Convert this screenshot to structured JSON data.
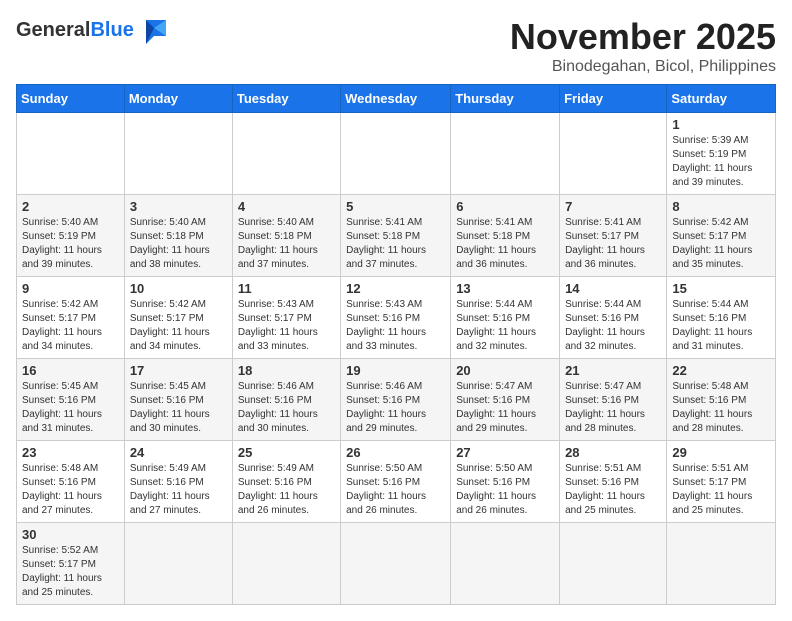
{
  "header": {
    "logo_general": "General",
    "logo_blue": "Blue",
    "month_title": "November 2025",
    "location": "Binodegahan, Bicol, Philippines"
  },
  "weekdays": [
    "Sunday",
    "Monday",
    "Tuesday",
    "Wednesday",
    "Thursday",
    "Friday",
    "Saturday"
  ],
  "weeks": [
    [
      {
        "day": "",
        "info": ""
      },
      {
        "day": "",
        "info": ""
      },
      {
        "day": "",
        "info": ""
      },
      {
        "day": "",
        "info": ""
      },
      {
        "day": "",
        "info": ""
      },
      {
        "day": "",
        "info": ""
      },
      {
        "day": "1",
        "info": "Sunrise: 5:39 AM\nSunset: 5:19 PM\nDaylight: 11 hours\nand 39 minutes."
      }
    ],
    [
      {
        "day": "2",
        "info": "Sunrise: 5:40 AM\nSunset: 5:19 PM\nDaylight: 11 hours\nand 39 minutes."
      },
      {
        "day": "3",
        "info": "Sunrise: 5:40 AM\nSunset: 5:18 PM\nDaylight: 11 hours\nand 38 minutes."
      },
      {
        "day": "4",
        "info": "Sunrise: 5:40 AM\nSunset: 5:18 PM\nDaylight: 11 hours\nand 37 minutes."
      },
      {
        "day": "5",
        "info": "Sunrise: 5:41 AM\nSunset: 5:18 PM\nDaylight: 11 hours\nand 37 minutes."
      },
      {
        "day": "6",
        "info": "Sunrise: 5:41 AM\nSunset: 5:18 PM\nDaylight: 11 hours\nand 36 minutes."
      },
      {
        "day": "7",
        "info": "Sunrise: 5:41 AM\nSunset: 5:17 PM\nDaylight: 11 hours\nand 36 minutes."
      },
      {
        "day": "8",
        "info": "Sunrise: 5:42 AM\nSunset: 5:17 PM\nDaylight: 11 hours\nand 35 minutes."
      }
    ],
    [
      {
        "day": "9",
        "info": "Sunrise: 5:42 AM\nSunset: 5:17 PM\nDaylight: 11 hours\nand 34 minutes."
      },
      {
        "day": "10",
        "info": "Sunrise: 5:42 AM\nSunset: 5:17 PM\nDaylight: 11 hours\nand 34 minutes."
      },
      {
        "day": "11",
        "info": "Sunrise: 5:43 AM\nSunset: 5:17 PM\nDaylight: 11 hours\nand 33 minutes."
      },
      {
        "day": "12",
        "info": "Sunrise: 5:43 AM\nSunset: 5:16 PM\nDaylight: 11 hours\nand 33 minutes."
      },
      {
        "day": "13",
        "info": "Sunrise: 5:44 AM\nSunset: 5:16 PM\nDaylight: 11 hours\nand 32 minutes."
      },
      {
        "day": "14",
        "info": "Sunrise: 5:44 AM\nSunset: 5:16 PM\nDaylight: 11 hours\nand 32 minutes."
      },
      {
        "day": "15",
        "info": "Sunrise: 5:44 AM\nSunset: 5:16 PM\nDaylight: 11 hours\nand 31 minutes."
      }
    ],
    [
      {
        "day": "16",
        "info": "Sunrise: 5:45 AM\nSunset: 5:16 PM\nDaylight: 11 hours\nand 31 minutes."
      },
      {
        "day": "17",
        "info": "Sunrise: 5:45 AM\nSunset: 5:16 PM\nDaylight: 11 hours\nand 30 minutes."
      },
      {
        "day": "18",
        "info": "Sunrise: 5:46 AM\nSunset: 5:16 PM\nDaylight: 11 hours\nand 30 minutes."
      },
      {
        "day": "19",
        "info": "Sunrise: 5:46 AM\nSunset: 5:16 PM\nDaylight: 11 hours\nand 29 minutes."
      },
      {
        "day": "20",
        "info": "Sunrise: 5:47 AM\nSunset: 5:16 PM\nDaylight: 11 hours\nand 29 minutes."
      },
      {
        "day": "21",
        "info": "Sunrise: 5:47 AM\nSunset: 5:16 PM\nDaylight: 11 hours\nand 28 minutes."
      },
      {
        "day": "22",
        "info": "Sunrise: 5:48 AM\nSunset: 5:16 PM\nDaylight: 11 hours\nand 28 minutes."
      }
    ],
    [
      {
        "day": "23",
        "info": "Sunrise: 5:48 AM\nSunset: 5:16 PM\nDaylight: 11 hours\nand 27 minutes."
      },
      {
        "day": "24",
        "info": "Sunrise: 5:49 AM\nSunset: 5:16 PM\nDaylight: 11 hours\nand 27 minutes."
      },
      {
        "day": "25",
        "info": "Sunrise: 5:49 AM\nSunset: 5:16 PM\nDaylight: 11 hours\nand 26 minutes."
      },
      {
        "day": "26",
        "info": "Sunrise: 5:50 AM\nSunset: 5:16 PM\nDaylight: 11 hours\nand 26 minutes."
      },
      {
        "day": "27",
        "info": "Sunrise: 5:50 AM\nSunset: 5:16 PM\nDaylight: 11 hours\nand 26 minutes."
      },
      {
        "day": "28",
        "info": "Sunrise: 5:51 AM\nSunset: 5:16 PM\nDaylight: 11 hours\nand 25 minutes."
      },
      {
        "day": "29",
        "info": "Sunrise: 5:51 AM\nSunset: 5:17 PM\nDaylight: 11 hours\nand 25 minutes."
      }
    ],
    [
      {
        "day": "30",
        "info": "Sunrise: 5:52 AM\nSunset: 5:17 PM\nDaylight: 11 hours\nand 25 minutes."
      },
      {
        "day": "",
        "info": ""
      },
      {
        "day": "",
        "info": ""
      },
      {
        "day": "",
        "info": ""
      },
      {
        "day": "",
        "info": ""
      },
      {
        "day": "",
        "info": ""
      },
      {
        "day": "",
        "info": ""
      }
    ]
  ]
}
